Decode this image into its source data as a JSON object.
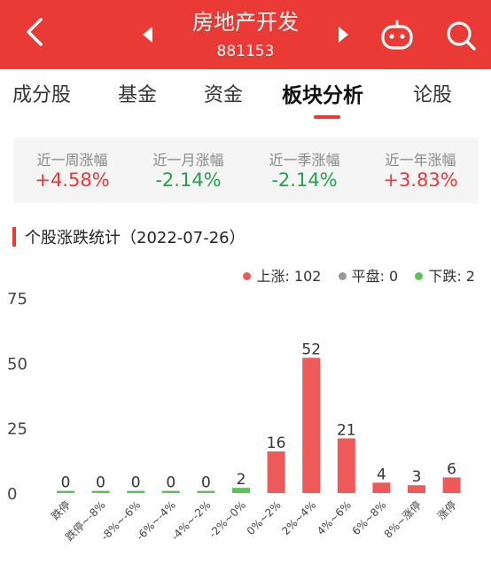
{
  "header": {
    "title": "房地产开发",
    "code": "881153",
    "icons": [
      "back-arrow-icon",
      "prev-arrow-icon",
      "next-arrow-icon",
      "robot-icon",
      "search-icon"
    ],
    "background": "#ea3a36"
  },
  "tabs": [
    {
      "label": "成分股"
    },
    {
      "label": "基金"
    },
    {
      "label": "资金"
    },
    {
      "label": "板块分析",
      "active": true
    },
    {
      "label": "论股"
    }
  ],
  "performance": [
    {
      "label": "近一周涨幅",
      "value": "+4.58%",
      "direction": "up"
    },
    {
      "label": "近一月涨幅",
      "value": "-2.14%",
      "direction": "down"
    },
    {
      "label": "近一季涨幅",
      "value": "-2.14%",
      "direction": "down"
    },
    {
      "label": "近一年涨幅",
      "value": "+3.83%",
      "direction": "up"
    }
  ],
  "section": {
    "title": "个股涨跌统计（2022-07-26）"
  },
  "legend": {
    "up": "上涨: 102",
    "flat": "平盘: 0",
    "down": "下跌: 2"
  },
  "colors": {
    "up": "#ee5a5a",
    "flat": "#999999",
    "down": "#5cc05c"
  },
  "chart_data": {
    "type": "bar",
    "categories": [
      "跌停",
      "跌停~-8%",
      "-8%~-6%",
      "-6%~-4%",
      "-4%~-2%",
      "-2%~0%",
      "0%~2%",
      "2%~4%",
      "4%~6%",
      "6%~8%",
      "8%~涨停",
      "涨停"
    ],
    "values": [
      0,
      0,
      0,
      0,
      0,
      2,
      16,
      52,
      21,
      4,
      3,
      6
    ],
    "bar_colors": [
      "down",
      "down",
      "down",
      "down",
      "down",
      "down",
      "up",
      "up",
      "up",
      "up",
      "up",
      "up"
    ],
    "yticks": [
      0,
      25,
      50,
      75
    ],
    "ylim": [
      0,
      75
    ],
    "grid": false
  }
}
